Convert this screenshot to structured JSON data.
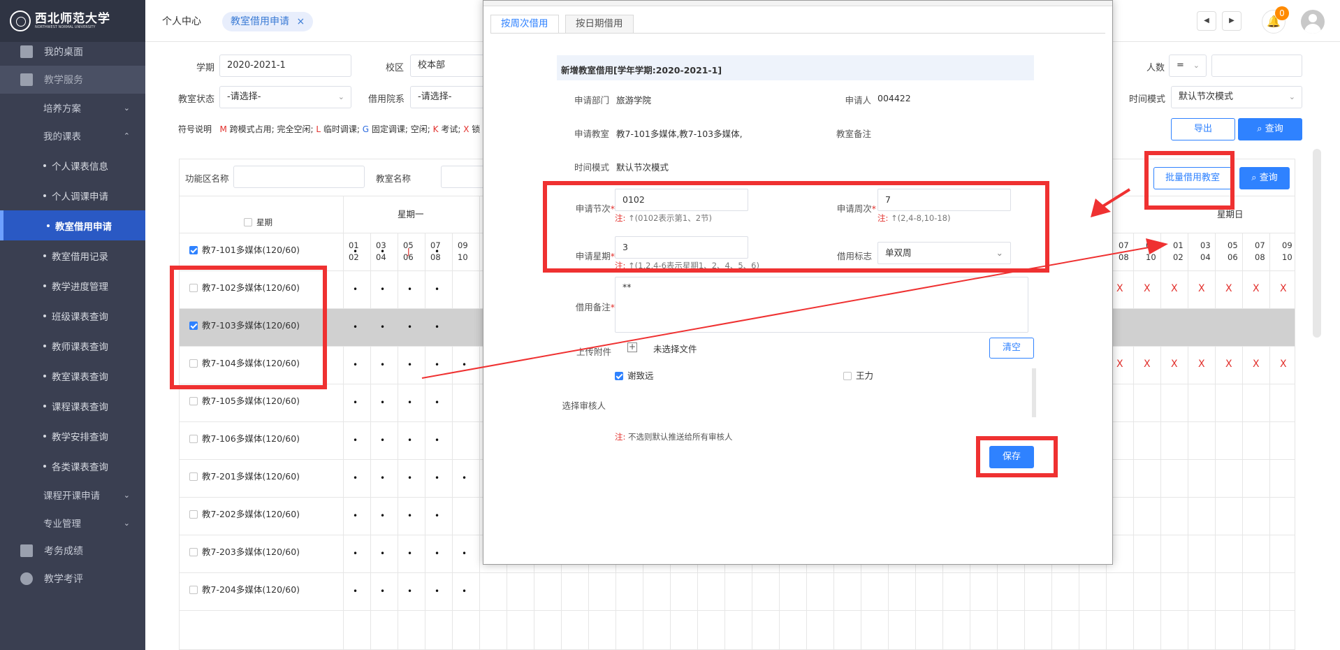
{
  "logo": {
    "name": "西北师范大学",
    "sub": "NORTHWEST NORMAL UNIVERSITY"
  },
  "sidebar": {
    "items": [
      {
        "label": "我的桌面",
        "icon": "windows-icon"
      },
      {
        "label": "教学服务",
        "icon": "chart-icon"
      },
      {
        "label": "培养方案"
      },
      {
        "label": "我的课表"
      },
      {
        "label": "个人课表信息"
      },
      {
        "label": "个人调课申请"
      },
      {
        "label": "教室借用申请"
      },
      {
        "label": "教室借用记录"
      },
      {
        "label": "教学进度管理"
      },
      {
        "label": "班级课表查询"
      },
      {
        "label": "教师课表查询"
      },
      {
        "label": "教室课表查询"
      },
      {
        "label": "课程课表查询"
      },
      {
        "label": "教学安排查询"
      },
      {
        "label": "各类课表查询"
      },
      {
        "label": "课程开课申请"
      },
      {
        "label": "专业管理"
      },
      {
        "label": "考务成绩",
        "icon": "book-icon"
      },
      {
        "label": "教学考评",
        "icon": "pie-icon"
      }
    ]
  },
  "header": {
    "crumb1": "个人中心",
    "tab": "教室借用申请",
    "tab_close": "×",
    "notif_count": "0",
    "prev": "◀",
    "next": "▶"
  },
  "filters": {
    "term_label": "学期",
    "term_value": "2020-2021-1",
    "campus_label": "校区",
    "campus_value": "校本部",
    "status_label": "教室状态",
    "status_value": "-请选择-",
    "dept_label": "借用院系",
    "dept_value": "-请选择-",
    "people_label": "人数",
    "people_op": "=",
    "time_mode_label": "时间模式",
    "time_mode_value": "默认节次模式",
    "export_label": "导出",
    "query_label": "查询",
    "legend": {
      "prefix": "符号说明",
      "m": "M",
      "m_text": "跨模式占用; 完全空闲;",
      "l": "L",
      "l_text": "临时调课;",
      "g": "G",
      "g_text": "固定调课; 空闲;",
      "k": "K",
      "k_text": "考试;",
      "x": "X",
      "x_text": "锁"
    },
    "area_label": "功能区名称",
    "room_label": "教室名称",
    "batch_label": "批量借用教室",
    "query2_label": "查询"
  },
  "grid": {
    "week_label": "星期",
    "day1": "星期一",
    "day7": "星期日",
    "periods_left": [
      [
        "01",
        "02"
      ],
      [
        "03",
        "04"
      ],
      [
        "05",
        "06"
      ],
      [
        "07",
        "08"
      ],
      [
        "09",
        "10"
      ]
    ],
    "periods_right_partial": [
      [
        "07",
        "08"
      ],
      [
        "09",
        "10"
      ]
    ],
    "periods_right": [
      [
        "01",
        "02"
      ],
      [
        "03",
        "04"
      ],
      [
        "05",
        "06"
      ],
      [
        "07",
        "08"
      ],
      [
        "09",
        "10"
      ]
    ],
    "rooms": [
      "教7-101多媒体(120/60)",
      "教7-102多媒体(120/60)",
      "教7-103多媒体(120/60)",
      "教7-104多媒体(120/60)",
      "教7-105多媒体(120/60)",
      "教7-106多媒体(120/60)",
      "教7-201多媒体(120/60)",
      "教7-202多媒体(120/60)",
      "教7-203多媒体(120/60)",
      "教7-204多媒体(120/60)"
    ],
    "dot": "•",
    "j": "J",
    "x": "X"
  },
  "modal": {
    "tab1": "按周次借用",
    "tab2": "按日期借用",
    "section_title": "新增教室借用[学年学期:2020-2021-1]",
    "dept_label": "申请部门",
    "dept_value": "旅游学院",
    "applicant_label": "申请人",
    "applicant_value": "004422",
    "rooms_label": "申请教室",
    "rooms_value": "教7-101多媒体,教7-103多媒体,",
    "room_note_label": "教室备注",
    "time_mode_label": "时间模式",
    "time_mode_value": "默认节次模式",
    "period_label": "申请节次",
    "period_value": "0102",
    "period_note": "(0102表示第1、2节)",
    "week_label": "申请周次",
    "week_value": "7",
    "week_note": "(2,4-8,10-18)",
    "weekday_label": "申请星期",
    "weekday_value": "3",
    "weekday_note": "(1,2,4-6表示星期1、2、4、5、6)",
    "flag_label": "借用标志",
    "flag_value": "单双周",
    "note_prefix": "注:",
    "remark_label": "借用备注",
    "remark_value": "**",
    "upload_label": "上传附件",
    "upload_status": "未选择文件",
    "clear_label": "清空",
    "reviewer_label": "选择审核人",
    "reviewer1": "谢致远",
    "reviewer2": "王力",
    "footer_note": "不选则默认推送给所有审核人",
    "save_label": "保存"
  }
}
